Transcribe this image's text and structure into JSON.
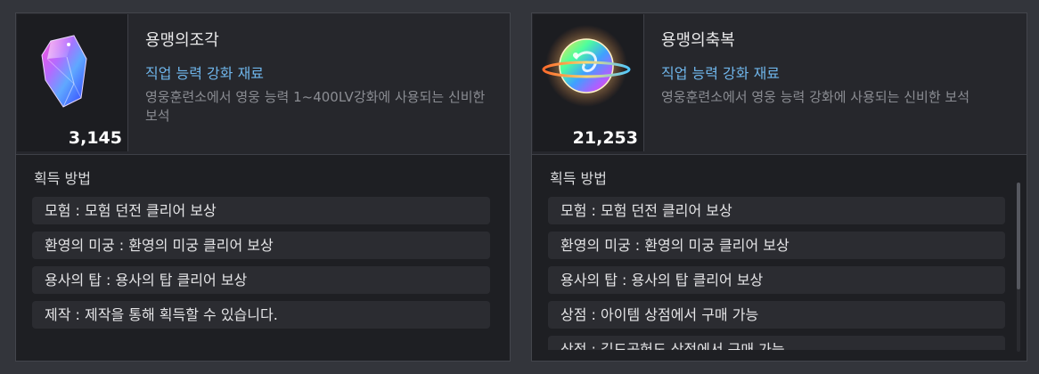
{
  "cards": [
    {
      "name": "용맹의조각",
      "category": "직업 능력 강화 재료",
      "description": "영웅훈련소에서 영웅 능력 1~400LV강화에 사용되는 신비한 보석",
      "quantity": "3,145",
      "icon": "crystal-shard-icon",
      "acquisition_title": "획득 방법",
      "acquisition": [
        "모험 : 모험 던전 클리어 보상",
        "환영의 미궁 : 환영의 미궁 클리어 보상",
        "용사의 탑 : 용사의 탑 클리어 보상",
        "제작 : 제작을 통해 획득할 수 있습니다."
      ]
    },
    {
      "name": "용맹의축복",
      "category": "직업 능력 강화 재료",
      "description": "영웅훈련소에서 영웅 능력 강화에 사용되는 신비한 보석",
      "quantity": "21,253",
      "icon": "rainbow-orb-icon",
      "acquisition_title": "획득 방법",
      "acquisition": [
        "모험 : 모험 던전 클리어 보상",
        "환영의 미궁 : 환영의 미궁 클리어 보상",
        "용사의 탑 : 용사의 탑 클리어 보상",
        "상점 : 아이템 상점에서 구매 가능",
        "상점 : 길드공헌도 상점에서 구매 가능"
      ]
    }
  ],
  "colors": {
    "background": "#33353b",
    "card": "#1e1f23",
    "category_text": "#6fb5ea",
    "row": "#2b2c31"
  }
}
